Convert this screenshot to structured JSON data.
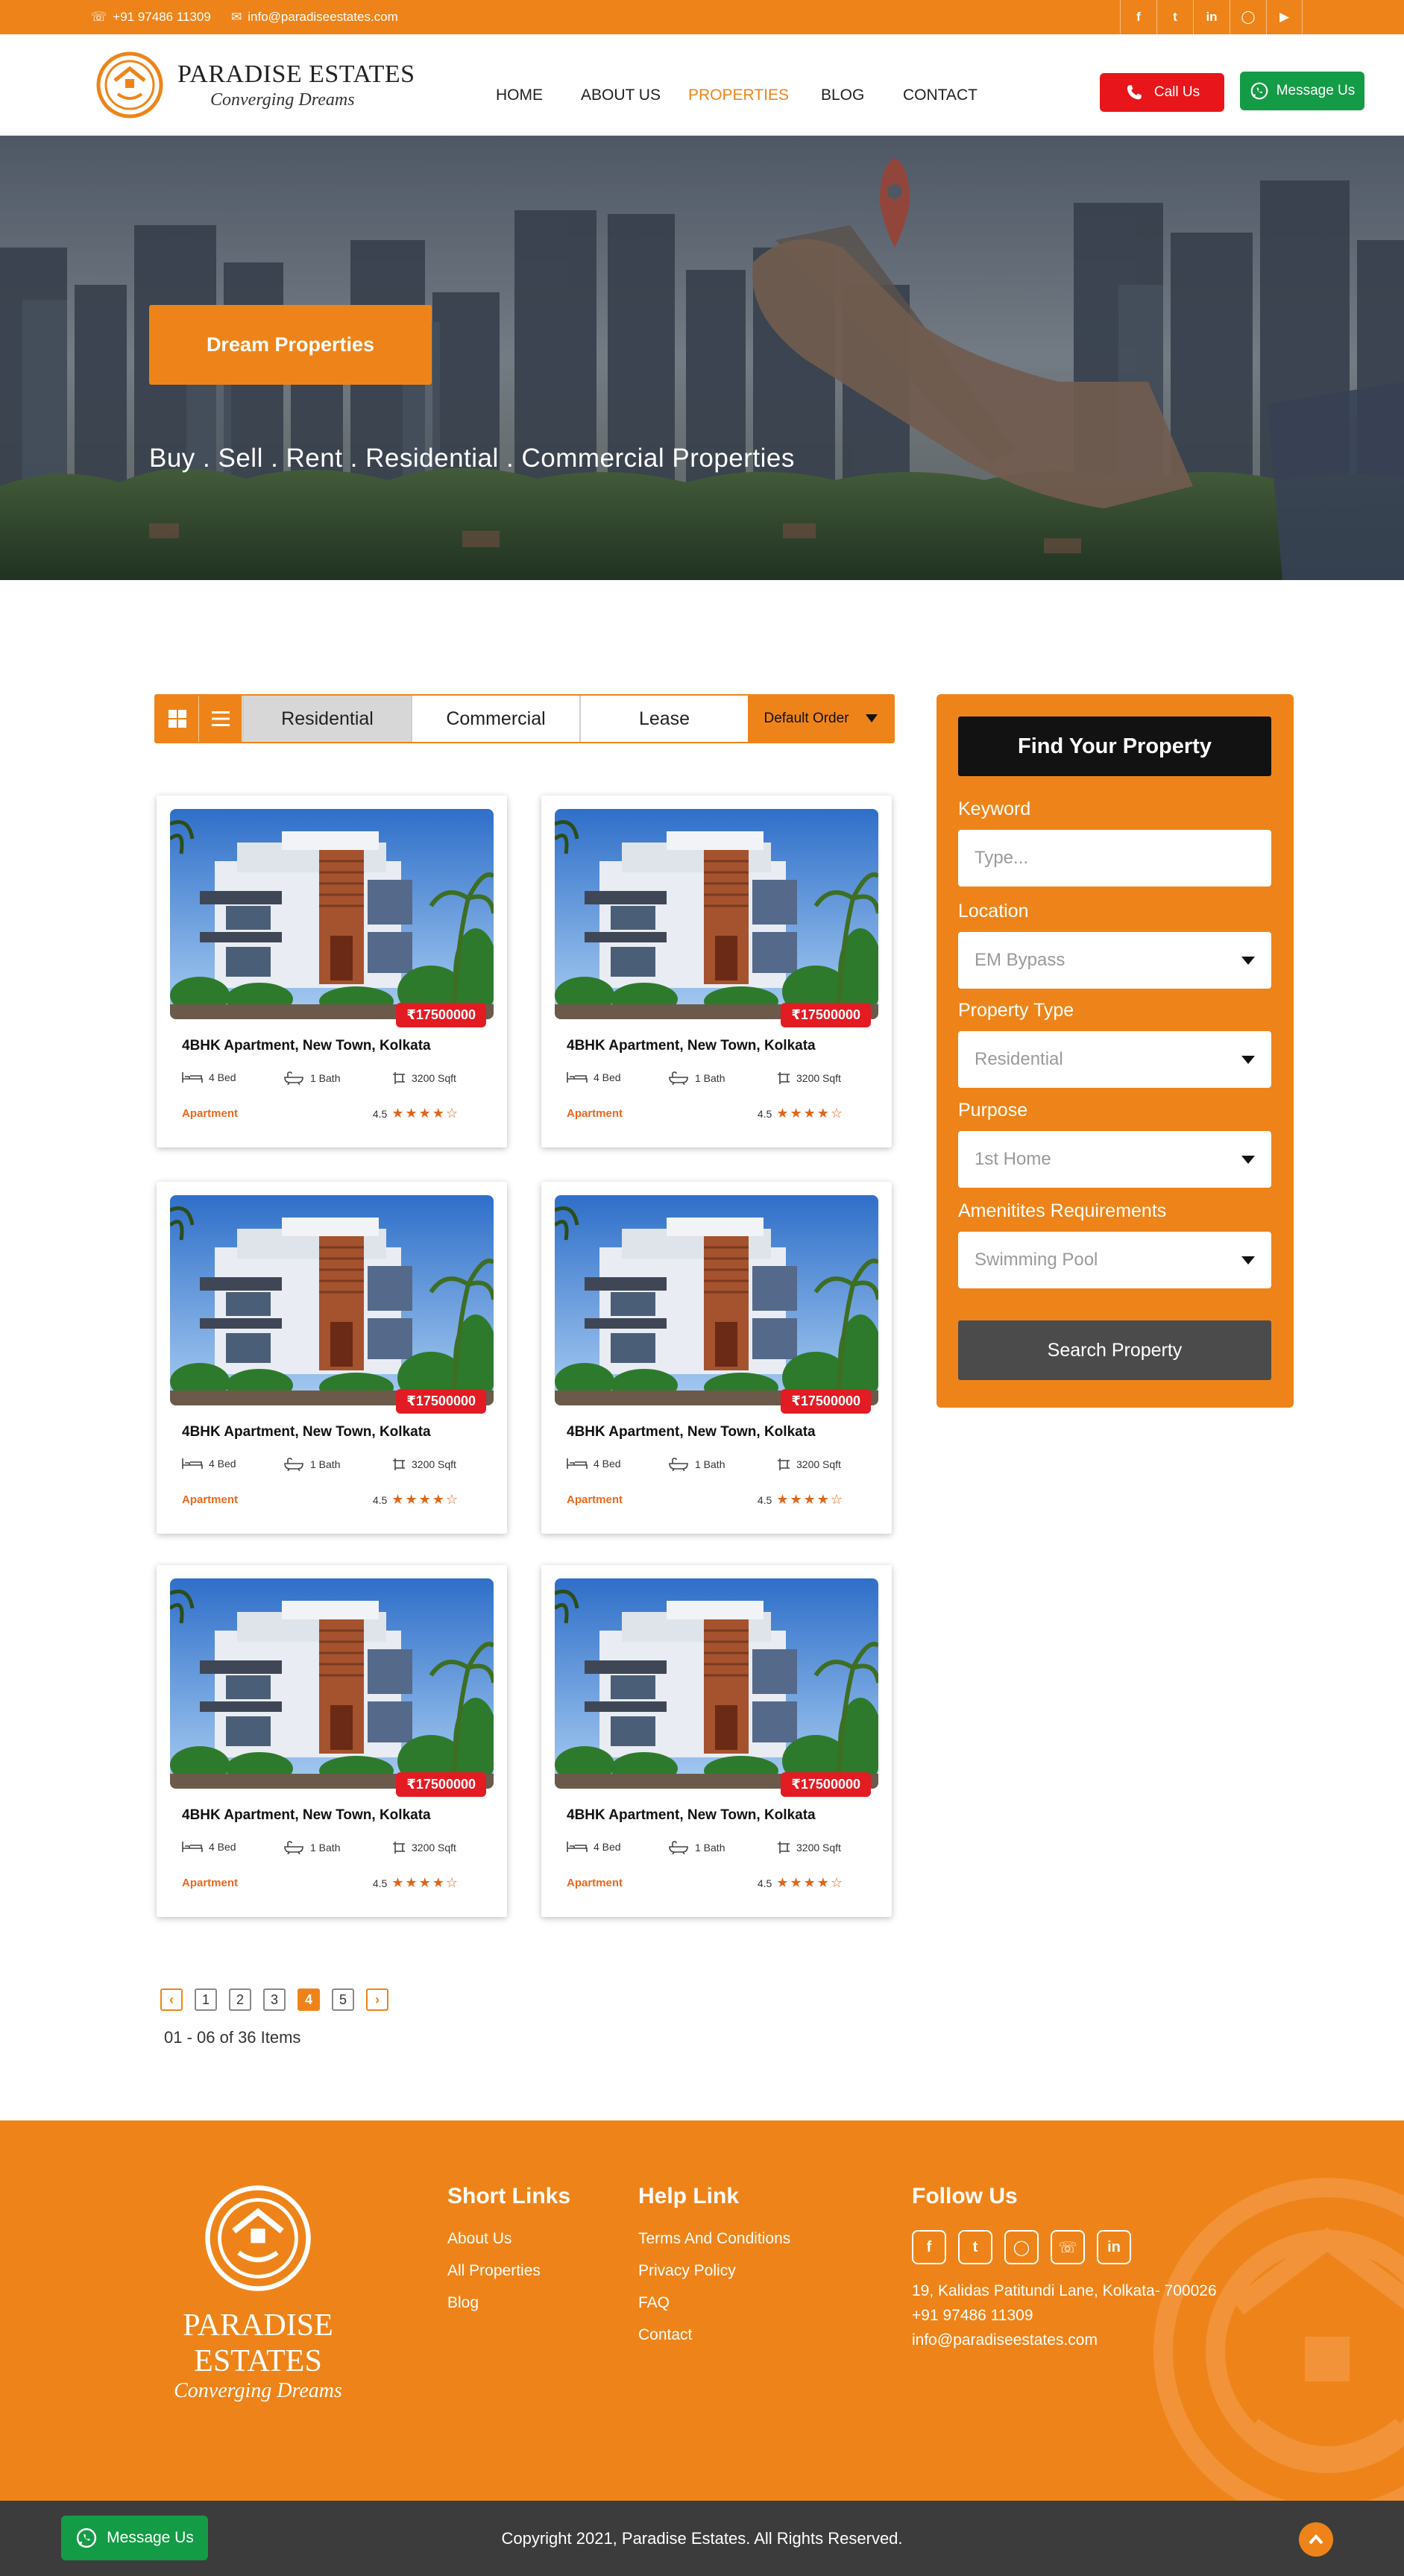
{
  "topbar": {
    "phone": "+91 97486 11309",
    "email": "info@paradiseestates.com",
    "socials": [
      "facebook-icon",
      "twitter-icon",
      "linkedin-icon",
      "instagram-icon",
      "youtube-icon"
    ]
  },
  "brand": {
    "title": "PARADISE ESTATES",
    "tagline": "Converging Dreams"
  },
  "nav": {
    "items": [
      "HOME",
      "ABOUT US",
      "PROPERTIES",
      "BLOG",
      "CONTACT"
    ],
    "active": "PROPERTIES"
  },
  "header_buttons": {
    "call": "Call Us",
    "message": "Message Us"
  },
  "hero": {
    "badge": "Dream Properties",
    "subtitle": "Buy . Sell . Rent . Residential . Commercial Properties"
  },
  "toolbar": {
    "tabs": [
      "Residential",
      "Commercial",
      "Lease"
    ],
    "active_tab": "Residential",
    "order": "Default Order"
  },
  "listings": [
    {
      "price": "₹17500000",
      "title": "4BHK Apartment, New Town, Kolkata",
      "bed": "4 Bed",
      "bath": "1 Bath",
      "area": "3200 Sqft",
      "type": "Apartment",
      "rating": "4.5"
    },
    {
      "price": "₹17500000",
      "title": "4BHK Apartment, New Town, Kolkata",
      "bed": "4 Bed",
      "bath": "1 Bath",
      "area": "3200 Sqft",
      "type": "Apartment",
      "rating": "4.5"
    },
    {
      "price": "₹17500000",
      "title": "4BHK Apartment, New Town, Kolkata",
      "bed": "4 Bed",
      "bath": "1 Bath",
      "area": "3200 Sqft",
      "type": "Apartment",
      "rating": "4.5"
    },
    {
      "price": "₹17500000",
      "title": "4BHK Apartment, New Town, Kolkata",
      "bed": "4 Bed",
      "bath": "1 Bath",
      "area": "3200 Sqft",
      "type": "Apartment",
      "rating": "4.5"
    },
    {
      "price": "₹17500000",
      "title": "4BHK Apartment, New Town, Kolkata",
      "bed": "4 Bed",
      "bath": "1 Bath",
      "area": "3200 Sqft",
      "type": "Apartment",
      "rating": "4.5"
    },
    {
      "price": "₹17500000",
      "title": "4BHK Apartment, New Town, Kolkata",
      "bed": "4 Bed",
      "bath": "1 Bath",
      "area": "3200 Sqft",
      "type": "Apartment",
      "rating": "4.5"
    }
  ],
  "pagination": {
    "pages": [
      "1",
      "2",
      "3",
      "4",
      "5"
    ],
    "current": "4",
    "summary": "01 - 06 of 36 Items"
  },
  "search": {
    "title": "Find Your Property",
    "keyword_label": "Keyword",
    "keyword_placeholder": "Type...",
    "location_label": "Location",
    "location_value": "EM Bypass",
    "type_label": "Property Type",
    "type_value": "Residential",
    "purpose_label": "Purpose",
    "purpose_value": "1st Home",
    "amenities_label": "Amenitites Requirements",
    "amenities_value": "Swimming Pool",
    "button": "Search Property"
  },
  "footer": {
    "short_links_title": "Short Links",
    "short_links": [
      "About Us",
      "All Properties",
      "Blog"
    ],
    "help_title": "Help Link",
    "help_links": [
      "Terms And Conditions",
      "Privacy Policy",
      "FAQ",
      "Contact"
    ],
    "follow_title": "Follow Us",
    "address": "19, Kalidas Patitundi Lane, Kolkata- 700026",
    "phone": "+91 97486 11309",
    "email": "info@paradiseestates.com",
    "copyright": "Copyright 2021, Paradise Estates. All Rights Reserved.",
    "message_button": "Message Us"
  },
  "colors": {
    "accent": "#ee8419",
    "dark": "#121212",
    "call": "#e8161a",
    "whatsapp": "#149b46",
    "price": "#e31b23"
  }
}
